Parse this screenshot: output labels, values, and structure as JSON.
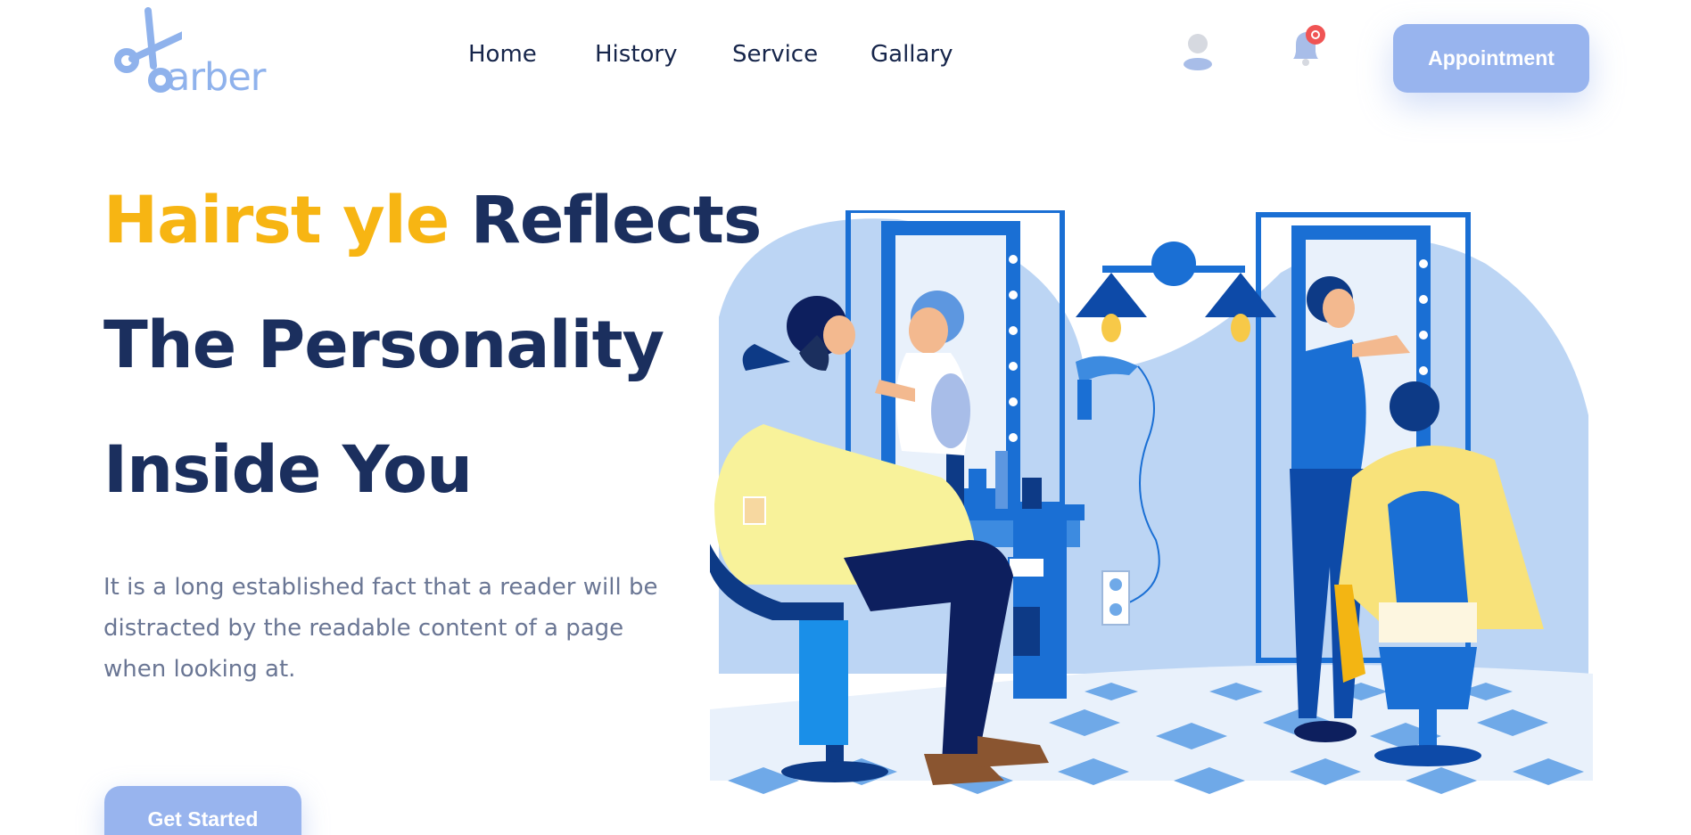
{
  "brand": {
    "logo_text": "arber",
    "icon": "scissors-icon"
  },
  "nav": {
    "items": [
      "Home",
      "History",
      "Service",
      "Gallary"
    ]
  },
  "header": {
    "user_icon": "user-icon",
    "bell_icon": "bell-icon",
    "appointment_label": "Appointment"
  },
  "hero": {
    "title_accent": "Hairst yle",
    "title_rest": " Reflects",
    "title_line2": "The Personality",
    "title_line3": "Inside You",
    "description": "It is a long established fact that a reader will be distracted by the readable content of a page when looking at.",
    "cta_label": "Get Started"
  },
  "colors": {
    "accent": "#f7b513",
    "primary": "#1b2f5e",
    "button": "#98b4ee",
    "muted": "#6a7694",
    "notification": "#f05454"
  }
}
